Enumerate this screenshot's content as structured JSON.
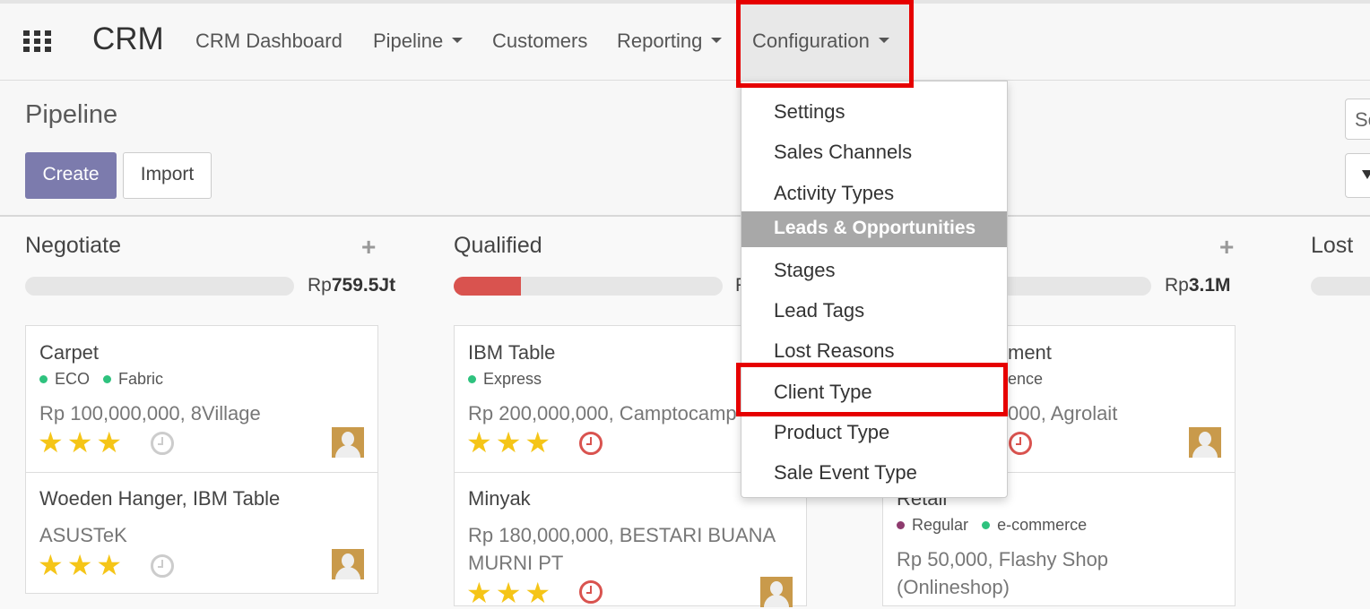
{
  "topbar": {
    "app_name": "CRM",
    "menu": [
      {
        "label": "CRM Dashboard",
        "has_caret": false
      },
      {
        "label": "Pipeline",
        "has_caret": true
      },
      {
        "label": "Customers",
        "has_caret": false
      },
      {
        "label": "Reporting",
        "has_caret": true
      },
      {
        "label": "Configuration",
        "has_caret": true,
        "active": true
      }
    ]
  },
  "control_panel": {
    "title": "Pipeline",
    "create_label": "Create",
    "import_label": "Import",
    "search_placeholder": "Se"
  },
  "config_dropdown": {
    "items_top": [
      "Settings",
      "Sales Channels",
      "Activity Types"
    ],
    "section_header": "Leads & Opportunities",
    "items_section": [
      "Stages",
      "Lead Tags",
      "Lost Reasons",
      "Client Type",
      "Product Type",
      "Sale Event Type"
    ]
  },
  "kanban": {
    "columns": [
      {
        "title": "Negotiate",
        "total_prefix": "Rp",
        "total_value": "759.5Jt",
        "progress": 0,
        "cards": [
          {
            "title": "Carpet",
            "tags": [
              {
                "label": "ECO",
                "color": "#2ec27e"
              },
              {
                "label": "Fabric",
                "color": "#2ec27e"
              }
            ],
            "amount": "Rp 100,000,000, 8Village",
            "stars": 3,
            "activity": "none"
          },
          {
            "title": "Woeden Hanger, IBM Table",
            "company": "ASUSTeK",
            "stars": 3,
            "activity": "none"
          }
        ]
      },
      {
        "title": "Qualified",
        "total_prefix": "R",
        "progress": 0.34,
        "cards": [
          {
            "title": "IBM Table",
            "tags": [
              {
                "label": "Express",
                "color": "#2ec27e"
              }
            ],
            "amount": "Rp 200,000,000, Camptocamp",
            "stars": 3,
            "activity": "overdue"
          },
          {
            "title": "Minyak",
            "amount_line1": "Rp 180,000,000, BESTARI BUANA",
            "amount_line2": "MURNI PT",
            "stars": 3,
            "activity": "overdue"
          }
        ]
      },
      {
        "title": "",
        "total_prefix": "Rp",
        "total_value": "3.1M",
        "progress": 0,
        "cards": [
          {
            "title_partial": "ment",
            "tag_partial": "ence",
            "amount_partial": "000, Agrolait",
            "activity": "overdue"
          },
          {
            "title_partial": "Retail",
            "tags": [
              {
                "label": "Regular",
                "color": "#8e3b6e"
              },
              {
                "label": "e-commerce",
                "color": "#2ec27e"
              }
            ],
            "amount_line1": "Rp 50,000, Flashy Shop",
            "amount_line2": "(Onlineshop)"
          }
        ]
      },
      {
        "title": "Lost"
      }
    ]
  },
  "colors": {
    "primary": "#7c7bad",
    "highlight": "#e60000",
    "danger": "#d9534f",
    "star": "#f5c518"
  }
}
